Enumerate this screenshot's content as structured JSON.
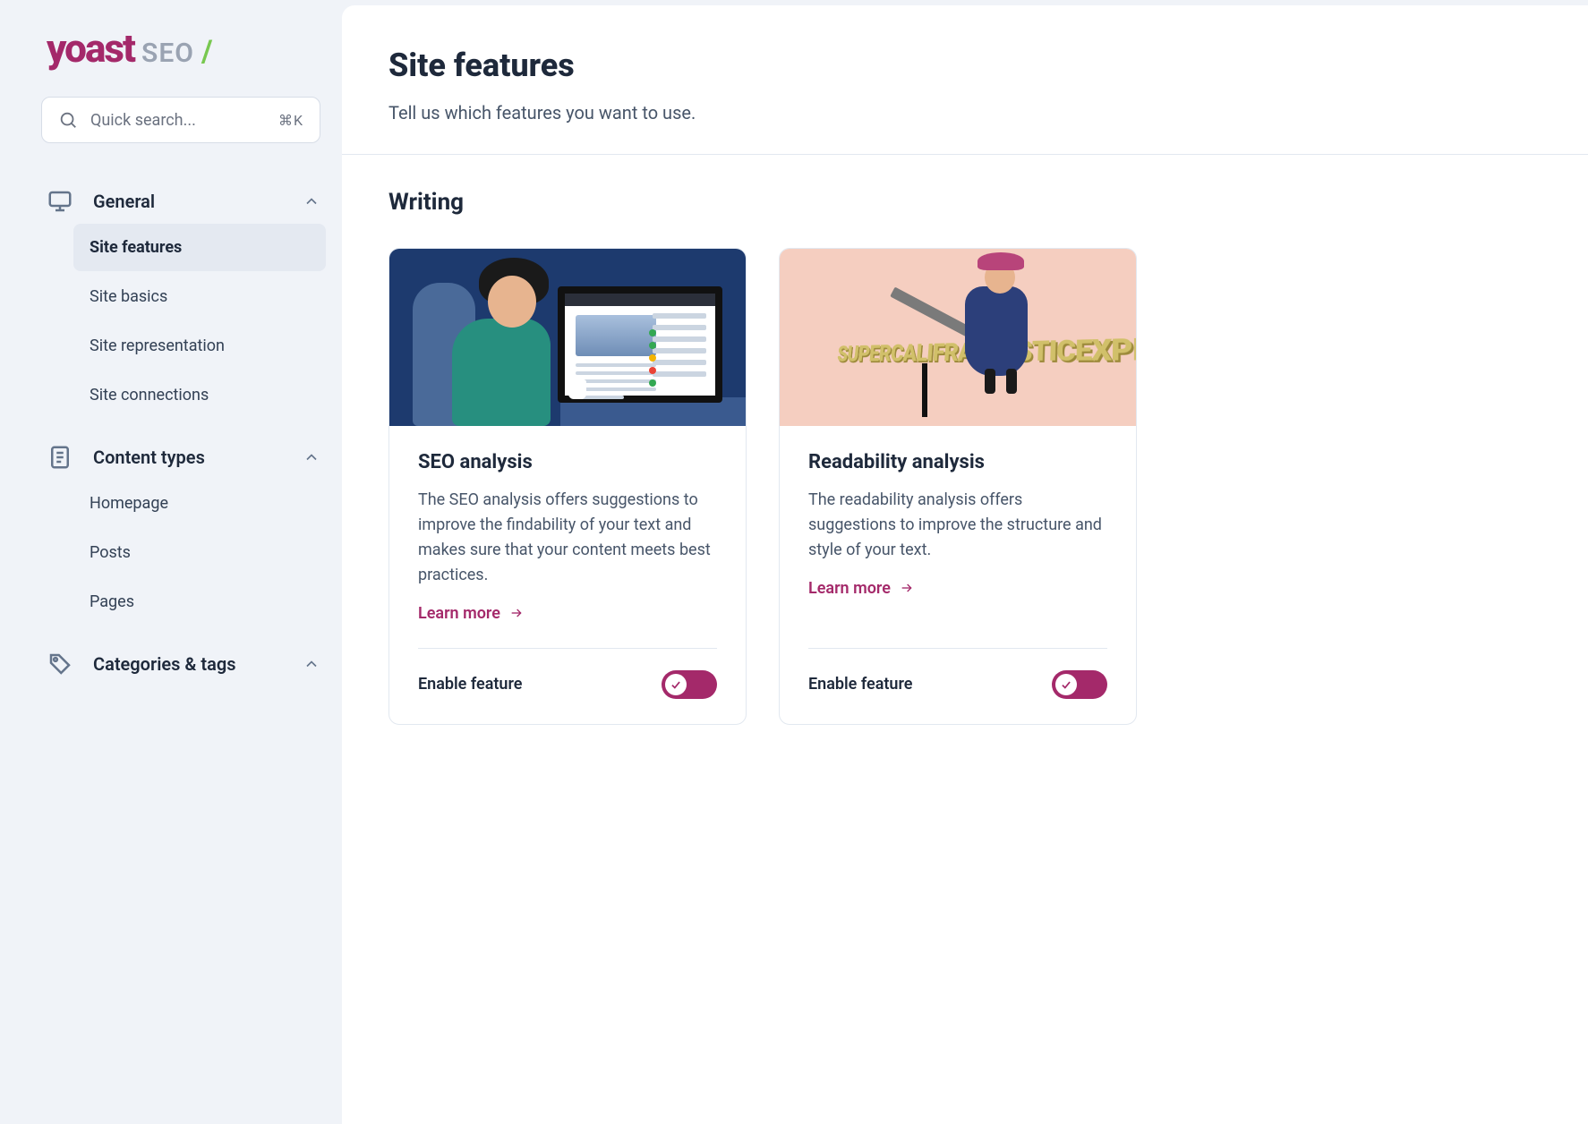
{
  "brand": {
    "name": "yoast",
    "suffix": "SEO",
    "slash": "/"
  },
  "search": {
    "placeholder": "Quick search...",
    "shortcut": "⌘K"
  },
  "sidebar": {
    "groups": [
      {
        "label": "General",
        "items": [
          {
            "label": "Site features",
            "active": true
          },
          {
            "label": "Site basics"
          },
          {
            "label": "Site representation"
          },
          {
            "label": "Site connections"
          }
        ]
      },
      {
        "label": "Content types",
        "items": [
          {
            "label": "Homepage"
          },
          {
            "label": "Posts"
          },
          {
            "label": "Pages"
          }
        ]
      },
      {
        "label": "Categories & tags",
        "items": []
      }
    ]
  },
  "page": {
    "title": "Site features",
    "subtitle": "Tell us which features you want to use."
  },
  "section": {
    "title": "Writing",
    "cards": [
      {
        "title": "SEO analysis",
        "desc": "The SEO analysis offers suggestions to improve the findability of your text and makes sure that your content meets best practices.",
        "learn": "Learn more",
        "enable": "Enable feature",
        "on": true,
        "word": ""
      },
      {
        "title": "Readability analysis",
        "desc": "The readability analysis offers suggestions to improve the structure and style of your text.",
        "learn": "Learn more",
        "enable": "Enable feature",
        "on": true,
        "word": "SUPERCALIFRAGILISTICEXPIALIDOCIOUS"
      }
    ]
  }
}
